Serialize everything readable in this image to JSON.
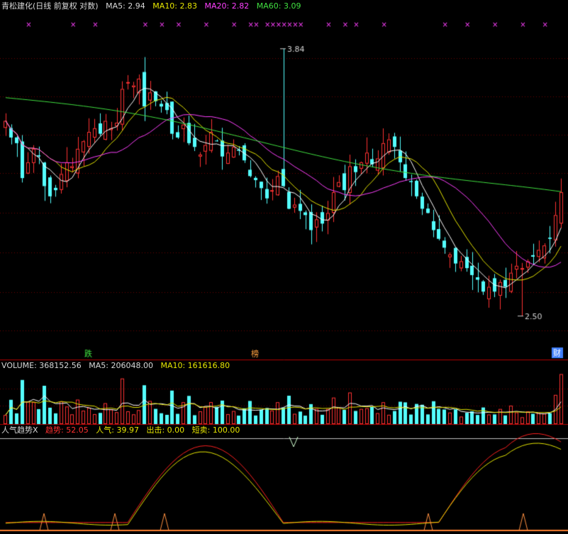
{
  "header": {
    "title": "青松建化(日线 前复权 对数)",
    "ma5": "MA5: 2.94",
    "ma10": "MA10: 2.83",
    "ma20": "MA20: 2.82",
    "ma60": "MA60: 3.09"
  },
  "volume_header": {
    "volume": "VOLUME: 368152.56",
    "ma5": "MA5: 206048.00",
    "ma10": "MA10: 161616.80"
  },
  "indicator_header": {
    "name": "人气趋势X",
    "trend": "趋势: 52.05",
    "popularity": "人气: 39.97",
    "exit": "出击: 0.00",
    "short": "短卖: 100.00"
  },
  "colors": {
    "background": "#000000",
    "up": "#ff3232",
    "down": "#54ffff",
    "ma5": "#ffffff",
    "ma10": "#e6e600",
    "ma20": "#ff40ff",
    "ma60": "#40e040",
    "separator": "#b00000"
  },
  "chart_data": {
    "type": "candlestick",
    "scale": "log",
    "ylim": [
      2.35,
      4.05
    ],
    "bars": 101,
    "annotations": {
      "high_label": "3.84",
      "low_label": "2.50",
      "marker_fall": "跌",
      "marker_rank": "榜",
      "marker_finance": "财"
    },
    "ohlc_close": [
      3.42,
      3.33,
      3.3,
      3.12,
      3.2,
      3.27,
      3.23,
      3.08,
      3.03,
      3.06,
      3.14,
      3.2,
      3.18,
      3.27,
      3.31,
      3.36,
      3.38,
      3.35,
      3.42,
      3.38,
      3.41,
      3.6,
      3.64,
      3.62,
      3.66,
      3.5,
      3.58,
      3.53,
      3.5,
      3.48,
      3.35,
      3.33,
      3.4,
      3.3,
      3.28,
      3.24,
      3.29,
      3.36,
      3.31,
      3.23,
      3.25,
      3.28,
      3.26,
      3.21,
      3.13,
      3.11,
      3.07,
      3.02,
      3.06,
      3.13,
      3.08,
      2.97,
      2.99,
      2.96,
      2.94,
      2.87,
      2.92,
      2.9,
      2.95,
      3.05,
      3.1,
      3.06,
      3.18,
      3.15,
      3.2,
      3.25,
      3.19,
      3.22,
      3.3,
      3.32,
      3.28,
      3.2,
      3.12,
      3.1,
      3.03,
      2.97,
      2.95,
      2.87,
      2.83,
      2.79,
      2.76,
      2.72,
      2.73,
      2.7,
      2.67,
      2.65,
      2.6,
      2.62,
      2.6,
      2.64,
      2.62,
      2.68,
      2.71,
      2.7,
      2.73,
      2.75,
      2.78,
      2.8,
      2.83,
      2.94,
      3.05
    ],
    "volume_max": 368152.56,
    "markers_x": [
      4,
      12,
      16,
      25,
      28,
      31,
      36,
      41,
      44,
      45,
      47,
      48,
      49,
      50,
      51,
      52,
      53,
      58,
      61,
      63,
      68,
      79,
      83,
      88,
      93,
      97
    ]
  }
}
